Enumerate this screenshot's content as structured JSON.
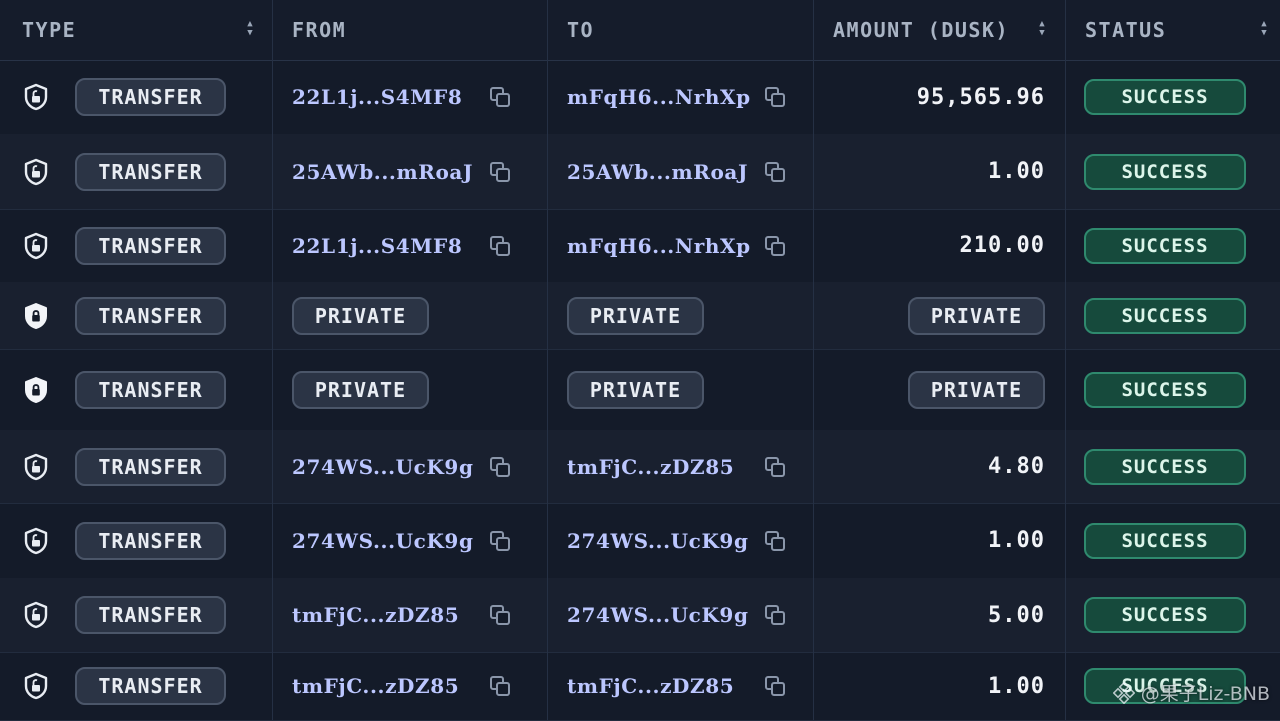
{
  "columns": {
    "type": "TYPE",
    "from": "FROM",
    "to": "TO",
    "amount": "AMOUNT (DUSK)",
    "status": "STATUS"
  },
  "icons": {
    "sort": "sort-arrows-icon",
    "shield_open": "shield-unlocked-icon",
    "shield_closed": "shield-locked-icon",
    "copy": "copy-icon"
  },
  "colors": {
    "background": "#141b29",
    "address": "#bcc7ff",
    "success_fill": "#164a3c",
    "success_border": "#2f8a6e"
  },
  "rows": [
    {
      "type": "TRANSFER",
      "shielded": false,
      "from": "22L1j...S4MF8",
      "to": "mFqH6...NrhXp",
      "amount": "95,565.96",
      "status": "SUCCESS"
    },
    {
      "type": "TRANSFER",
      "shielded": false,
      "from": "25AWb...mRoaJ",
      "to": "25AWb...mRoaJ",
      "amount": "1.00",
      "status": "SUCCESS"
    },
    {
      "type": "TRANSFER",
      "shielded": false,
      "from": "22L1j...S4MF8",
      "to": "mFqH6...NrhXp",
      "amount": "210.00",
      "status": "SUCCESS"
    },
    {
      "type": "TRANSFER",
      "shielded": true,
      "from": "PRIVATE",
      "to": "PRIVATE",
      "amount": "PRIVATE",
      "status": "SUCCESS"
    },
    {
      "type": "TRANSFER",
      "shielded": true,
      "from": "PRIVATE",
      "to": "PRIVATE",
      "amount": "PRIVATE",
      "status": "SUCCESS"
    },
    {
      "type": "TRANSFER",
      "shielded": false,
      "from": "274WS...UcK9g",
      "to": "tmFjC...zDZ85",
      "amount": "4.80",
      "status": "SUCCESS"
    },
    {
      "type": "TRANSFER",
      "shielded": false,
      "from": "274WS...UcK9g",
      "to": "274WS...UcK9g",
      "amount": "1.00",
      "status": "SUCCESS"
    },
    {
      "type": "TRANSFER",
      "shielded": false,
      "from": "tmFjC...zDZ85",
      "to": "274WS...UcK9g",
      "amount": "5.00",
      "status": "SUCCESS"
    },
    {
      "type": "TRANSFER",
      "shielded": false,
      "from": "tmFjC...zDZ85",
      "to": "tmFjC...zDZ85",
      "amount": "1.00",
      "status": "SUCCESS"
    }
  ],
  "watermark": "@果子Liz-BNB"
}
